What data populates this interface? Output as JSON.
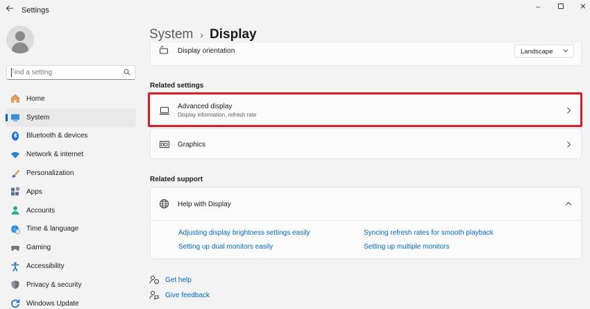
{
  "window": {
    "title": "Settings",
    "controls": {
      "minimize": "–",
      "close": "✕"
    }
  },
  "search": {
    "placeholder": "Find a setting"
  },
  "sidebar": {
    "items": [
      {
        "label": "Home",
        "icon": "home-icon"
      },
      {
        "label": "System",
        "icon": "system-icon",
        "selected": true
      },
      {
        "label": "Bluetooth & devices",
        "icon": "bluetooth-icon"
      },
      {
        "label": "Network & internet",
        "icon": "wifi-icon"
      },
      {
        "label": "Personalization",
        "icon": "brush-icon"
      },
      {
        "label": "Apps",
        "icon": "apps-icon"
      },
      {
        "label": "Accounts",
        "icon": "accounts-icon"
      },
      {
        "label": "Time & language",
        "icon": "globe-clock-icon"
      },
      {
        "label": "Gaming",
        "icon": "gamepad-icon"
      },
      {
        "label": "Accessibility",
        "icon": "accessibility-icon"
      },
      {
        "label": "Privacy & security",
        "icon": "shield-icon"
      },
      {
        "label": "Windows Update",
        "icon": "update-icon"
      }
    ]
  },
  "breadcrumb": {
    "parent": "System",
    "separator": "›",
    "current": "Display"
  },
  "orientation": {
    "label": "Display orientation",
    "value": "Landscape"
  },
  "related_settings": {
    "title": "Related settings",
    "advanced": {
      "title": "Advanced display",
      "subtitle": "Display information, refresh rate"
    },
    "graphics": {
      "title": "Graphics"
    }
  },
  "related_support": {
    "title": "Related support",
    "help": {
      "title": "Help with Display",
      "links": [
        "Adjusting display brightness settings easily",
        "Setting up dual monitors easily",
        "Syncing refresh rates for smooth playback",
        "Setting up multiple monitors"
      ]
    }
  },
  "footer": {
    "get_help": "Get help",
    "give_feedback": "Give feedback"
  },
  "colors": {
    "accent": "#0067c0",
    "highlight": "#d0202c",
    "background": "#f3f3f3",
    "card": "#fbfbfb"
  }
}
